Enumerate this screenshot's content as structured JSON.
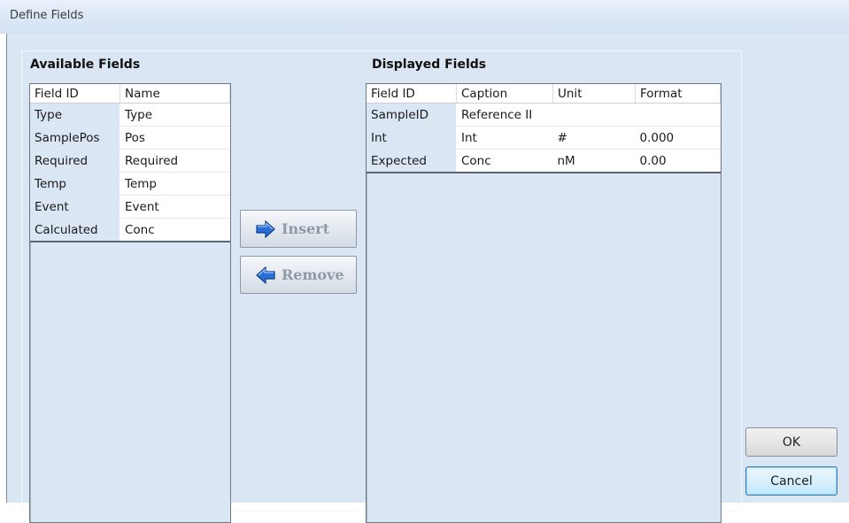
{
  "window": {
    "title": "Define Fields"
  },
  "available": {
    "title": "Available Fields",
    "headers": [
      "Field ID",
      "Name"
    ],
    "rows": [
      [
        "Type",
        "Type"
      ],
      [
        "SamplePos",
        "Pos"
      ],
      [
        "Required",
        "Required"
      ],
      [
        "Temp",
        "Temp"
      ],
      [
        "Event",
        "Event"
      ],
      [
        "Calculated",
        "Conc"
      ]
    ]
  },
  "displayed": {
    "title": "Displayed Fields",
    "headers": [
      "Field ID",
      "Caption",
      "Unit",
      "Format"
    ],
    "rows": [
      [
        "SampleID",
        "Reference II",
        "",
        ""
      ],
      [
        "Int",
        "Int",
        "#",
        "0.000"
      ],
      [
        "Expected",
        "Conc",
        "nM",
        "0.00"
      ]
    ]
  },
  "actions": {
    "insert_label": "Insert",
    "remove_label": "Remove"
  },
  "dialog_buttons": {
    "ok_label": "OK",
    "cancel_label": "Cancel"
  },
  "icons": {
    "insert": "arrow-right-icon",
    "remove": "arrow-left-icon"
  },
  "colors": {
    "dialog_bg": "#dbe6f4",
    "arrow_blue": "#2a6fd6"
  }
}
